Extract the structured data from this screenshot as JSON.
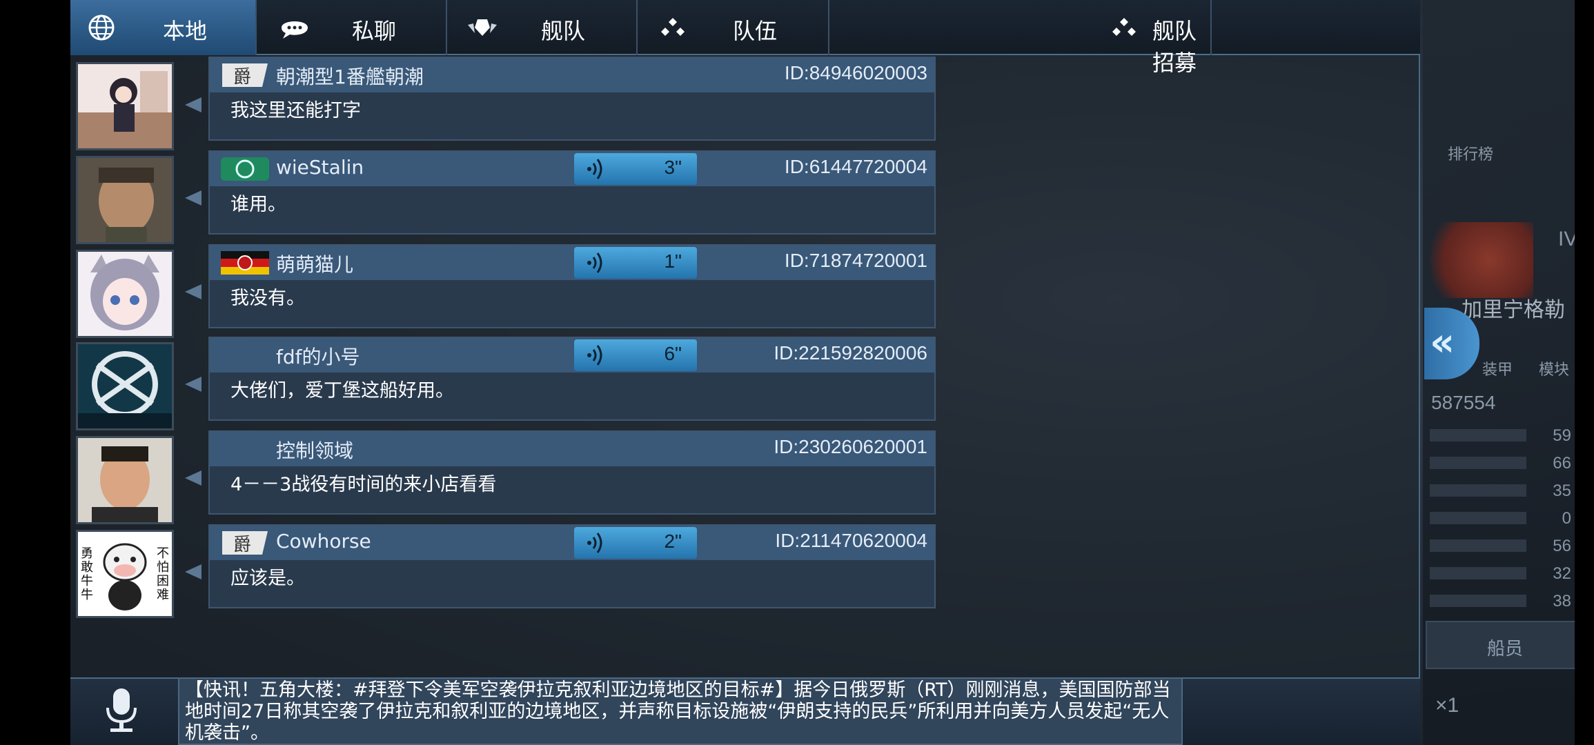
{
  "tabs": [
    {
      "label": "本地",
      "icon": "globe-icon",
      "active": true
    },
    {
      "label": "私聊",
      "icon": "chat-bubble-icon",
      "active": false
    },
    {
      "label": "舰队",
      "icon": "fleet-emblem-icon",
      "active": false
    },
    {
      "label": "队伍",
      "icon": "team-dots-icon",
      "active": false
    },
    {
      "label": "舰队招募",
      "icon": "recruit-dots-icon",
      "active": false
    }
  ],
  "messages": [
    {
      "username": "朝潮型1番艦朝潮",
      "id": "ID:84946020003",
      "text": "我这里还能打字",
      "voice": null,
      "badge": "rank-badge-icon"
    },
    {
      "username": "wieStalin",
      "id": "ID:61447720004",
      "text": "谁用。",
      "voice": "3\"",
      "badge": "wreath-badge-icon"
    },
    {
      "username": "萌萌猫儿",
      "id": "ID:71874720001",
      "text": "我没有。",
      "voice": "1\"",
      "badge": "flag-badge-icon"
    },
    {
      "username": "fdf的小号",
      "id": "ID:221592820006",
      "text": "大佬们，爱丁堡这船好用。",
      "voice": "6\"",
      "badge": null
    },
    {
      "username": "控制领域",
      "id": "ID:230260620001",
      "text": "4－－3战役有时间的来小店看看",
      "voice": null,
      "badge": null
    },
    {
      "username": "Cowhorse",
      "id": "ID:211470620004",
      "text": "应该是。",
      "voice": "2\"",
      "badge": "rank-badge-icon"
    }
  ],
  "avatar6_text": {
    "left": "勇敢牛牛",
    "right": "不怕困难"
  },
  "news": "【快讯！五角大楼：#拜登下令美军空袭伊拉克叙利亚边境地区的目标#】据今日俄罗斯（RT）刚刚消息，美国国防部当地时间27日称其空袭了伊拉克和叙利亚的边境地区，并声称目标设施被“伊朗支持的民兵”所利用并向美方人员发起“无人机袭击”。",
  "right_panel": {
    "rank_label": "排行榜",
    "tier": "IV",
    "ship_name": "加里宁格勒",
    "armor_label": "装甲",
    "module_label": "模块",
    "power": "587554",
    "stats": [
      "59",
      "66",
      "35",
      "0",
      "56",
      "32",
      "38"
    ],
    "crew_label": "船员",
    "multiplier": "×1"
  },
  "colors": {
    "accent": "#3c6d9d",
    "voice": "#4da9dd",
    "bubble": "#2a3a4d",
    "bubble_head": "#3a5878"
  }
}
